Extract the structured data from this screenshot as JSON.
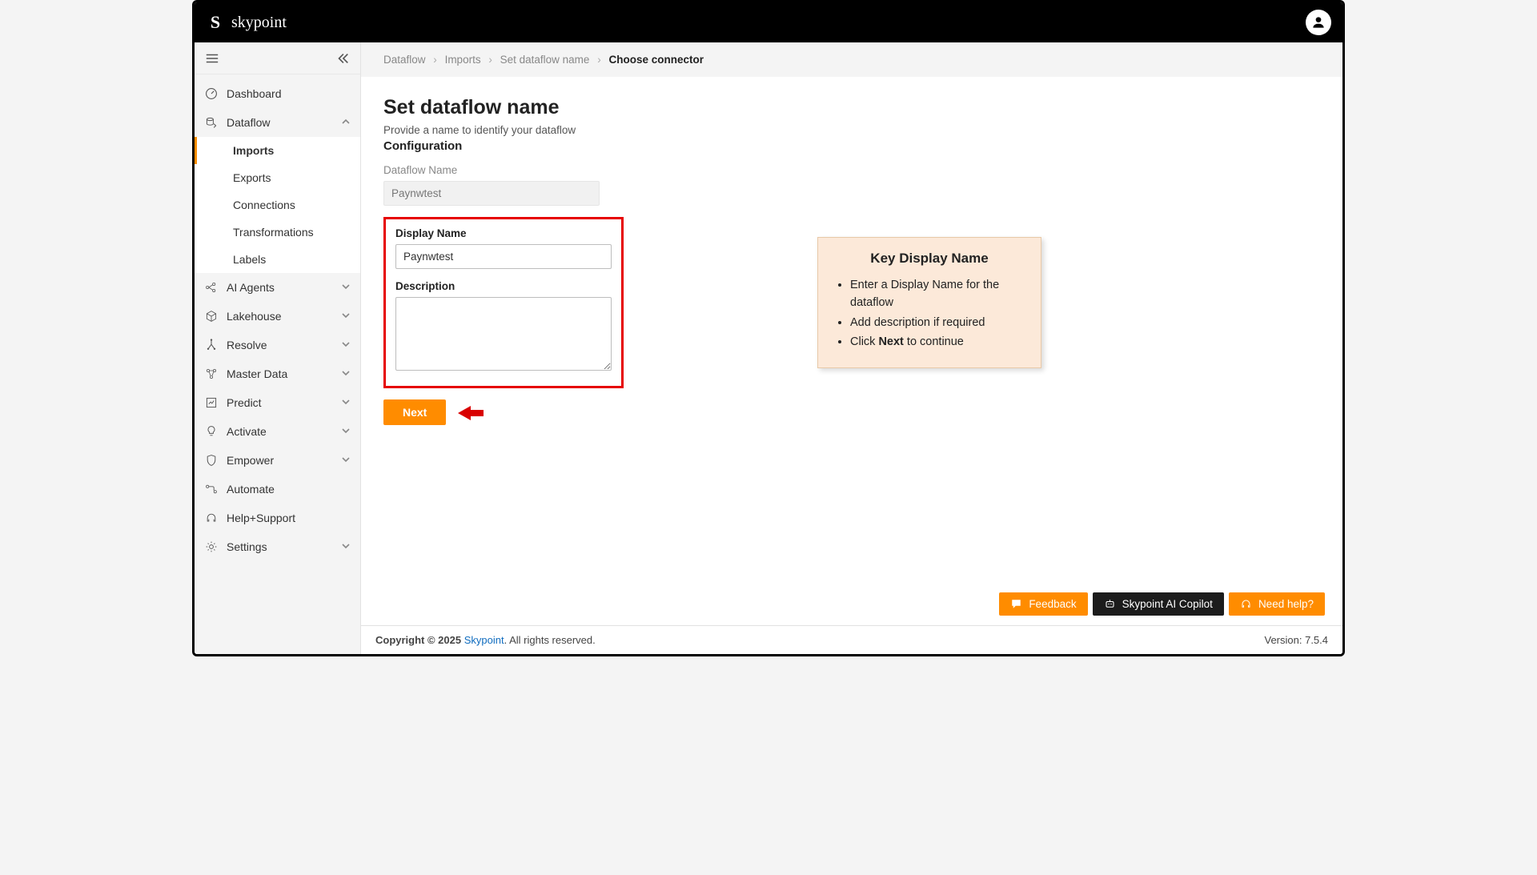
{
  "brand": {
    "name": "skypoint",
    "logo_glyph": "S"
  },
  "breadcrumb": {
    "items": [
      "Dataflow",
      "Imports",
      "Set dataflow name"
    ],
    "current": "Choose connector"
  },
  "sidebar": {
    "dashboard": "Dashboard",
    "dataflow": {
      "label": "Dataflow",
      "children": {
        "imports": "Imports",
        "exports": "Exports",
        "connections": "Connections",
        "transformations": "Transformations",
        "labels": "Labels"
      }
    },
    "ai_agents": "AI Agents",
    "lakehouse": "Lakehouse",
    "resolve": "Resolve",
    "master_data": "Master Data",
    "predict": "Predict",
    "activate": "Activate",
    "empower": "Empower",
    "automate": "Automate",
    "help_support": "Help+Support",
    "settings": "Settings"
  },
  "page": {
    "title": "Set dataflow name",
    "subhead": "Provide a name to identify your dataflow",
    "section": "Configuration",
    "dataflow_name_label": "Dataflow Name",
    "dataflow_name_value": "Paynwtest",
    "display_name_label": "Display Name",
    "display_name_value": "Paynwtest",
    "description_label": "Description",
    "description_value": "",
    "next_button": "Next"
  },
  "callout": {
    "title": "Key Display Name",
    "bullets": {
      "b1": "Enter a Display Name for the dataflow",
      "b2": "Add description if required",
      "b3_pre": "Click ",
      "b3_bold": "Next",
      "b3_post": " to continue"
    }
  },
  "actionbar": {
    "feedback": "Feedback",
    "copilot": "Skypoint AI Copilot",
    "need_help": "Need help?"
  },
  "footer": {
    "copyright_pre": "Copyright © 2025 ",
    "brand": "Skypoint",
    "copyright_post": ". All rights reserved.",
    "version": "Version: 7.5.4"
  }
}
